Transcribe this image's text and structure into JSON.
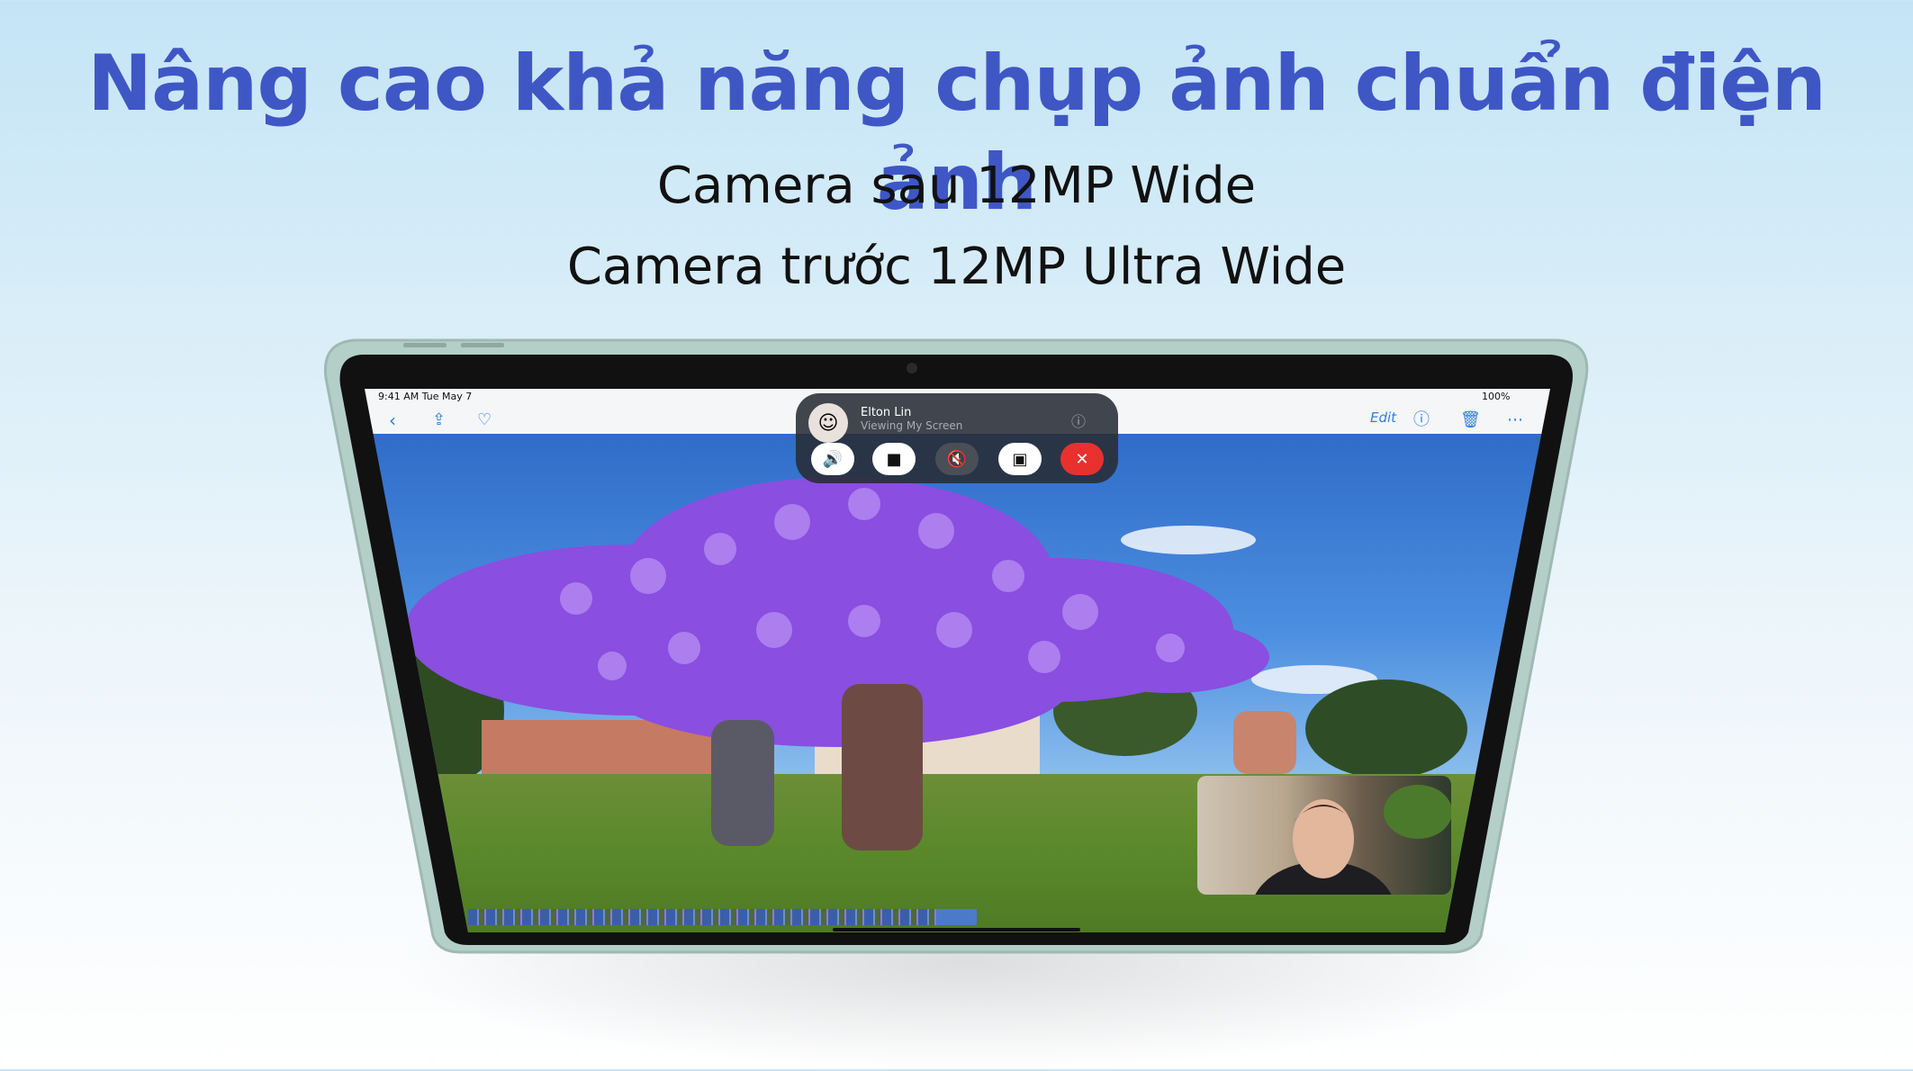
{
  "headline": "Nâng cao khả năng chụp ảnh chuẩn điện ảnh",
  "subtitles": [
    "Camera sau 12MP Wide",
    "Camera trước 12MP Ultra Wide"
  ],
  "device": {
    "status_bar": {
      "time": "9:41 AM   Tue May 7",
      "battery": "100%"
    },
    "photos_toolbar": {
      "edit_label": "Edit"
    },
    "facetime": {
      "caller_name": "Elton Lin",
      "status": "Viewing My Screen"
    }
  },
  "colors": {
    "headline": "#3f57c5",
    "accent_blue": "#2f7de0",
    "end_call_red": "#e8312f"
  }
}
